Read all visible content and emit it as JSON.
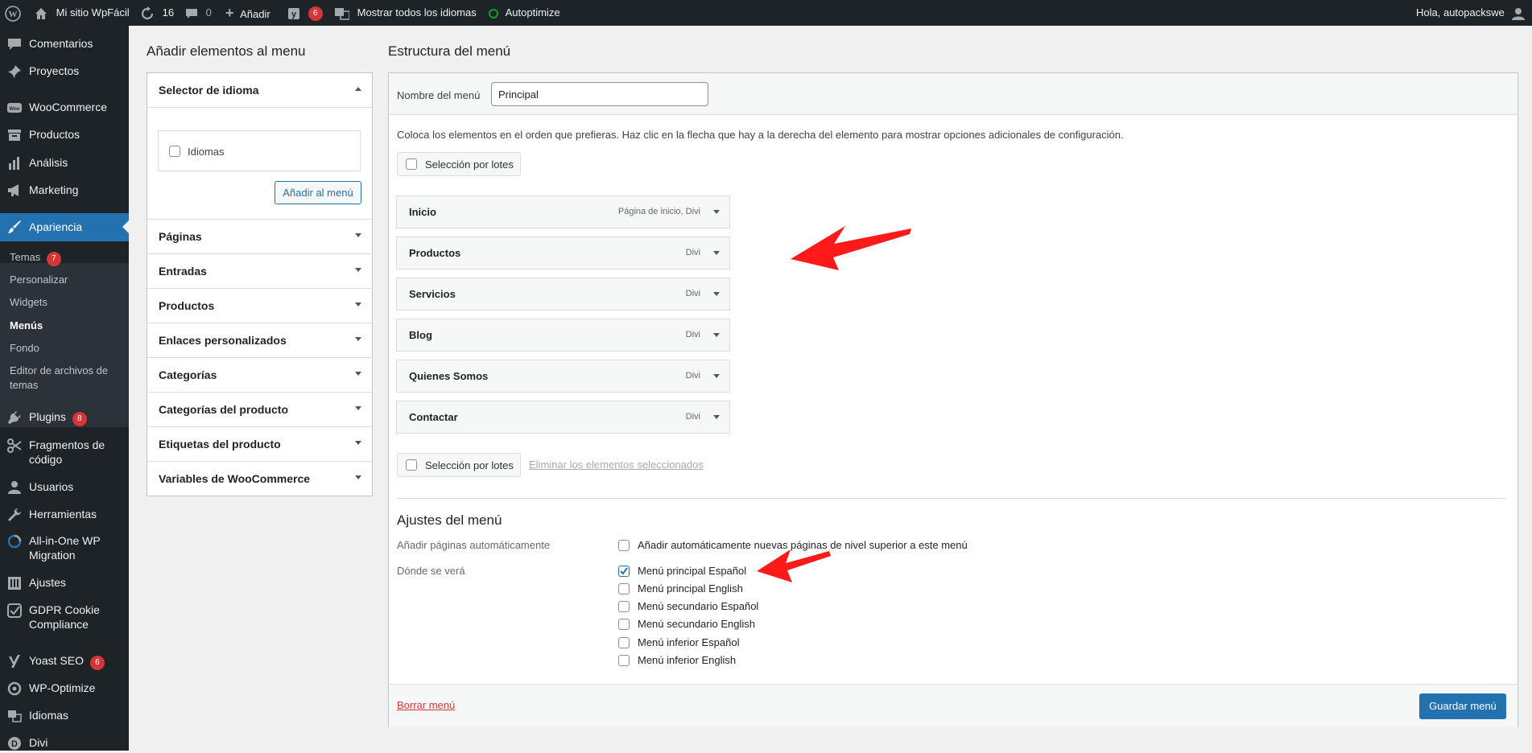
{
  "adminbar": {
    "site_name": "Mi sitio WpFácil",
    "updates_count": "16",
    "comments_count": "0",
    "add_new": "Añadir",
    "yoast_count": "6",
    "languages": "Mostrar todos los idiomas",
    "autoptimize": "Autoptimize",
    "greeting": "Hola, autopackswe"
  },
  "sidebar": {
    "items": [
      {
        "label": "Comentarios",
        "icon": "comments-icon"
      },
      {
        "label": "Proyectos",
        "icon": "pin-icon"
      },
      {
        "label": "WooCommerce",
        "icon": "woo-icon"
      },
      {
        "label": "Productos",
        "icon": "archive-icon"
      },
      {
        "label": "Análisis",
        "icon": "chart-icon"
      },
      {
        "label": "Marketing",
        "icon": "megaphone-icon"
      },
      {
        "label": "Apariencia",
        "icon": "brush-icon"
      },
      {
        "label": "Plugins",
        "icon": "plug-icon",
        "badge": "8"
      },
      {
        "label": "Fragmentos de código",
        "icon": "scissors-icon"
      },
      {
        "label": "Usuarios",
        "icon": "user-icon"
      },
      {
        "label": "Herramientas",
        "icon": "wrench-icon"
      },
      {
        "label": "All-in-One WP Migration",
        "icon": "migration-icon"
      },
      {
        "label": "Ajustes",
        "icon": "settings-icon"
      },
      {
        "label": "GDPR Cookie Compliance",
        "icon": "gdpr-icon"
      },
      {
        "label": "Yoast SEO",
        "icon": "yoast-icon",
        "badge": "6"
      },
      {
        "label": "WP-Optimize",
        "icon": "optimize-icon"
      },
      {
        "label": "Idiomas",
        "icon": "language-icon"
      },
      {
        "label": "Divi",
        "icon": "divi-icon"
      }
    ],
    "submenu": {
      "temas": "Temas",
      "temas_badge": "7",
      "personalizar": "Personalizar",
      "widgets": "Widgets",
      "menus": "Menús",
      "fondo": "Fondo",
      "editor": "Editor de archivos de temas"
    }
  },
  "left": {
    "title": "Añadir elementos al menu",
    "selector_title": "Selector de idioma",
    "idiomas_label": "Idiomas",
    "add_button": "Añadir al menú",
    "sections": [
      "Páginas",
      "Entradas",
      "Productos",
      "Enlaces personalizados",
      "Categorías",
      "Categorías del producto",
      "Etiquetas del producto",
      "Variables de WooCommerce"
    ]
  },
  "right": {
    "title": "Estructura del menú",
    "name_label": "Nombre del menú",
    "name_value": "Principal",
    "instructions": "Coloca los elementos en el orden que prefieras. Haz clic en la flecha que hay a la derecha del elemento para mostrar opciones adicionales de configuración.",
    "bulk_select": "Selección por lotes",
    "delete_selected": "Eliminar los elementos seleccionados",
    "items": [
      {
        "title": "Inicio",
        "type": "Página de inicio, Divi"
      },
      {
        "title": "Productos",
        "type": "Divi"
      },
      {
        "title": "Servicios",
        "type": "Divi"
      },
      {
        "title": "Blog",
        "type": "Divi"
      },
      {
        "title": "Quienes Somos",
        "type": "Divi"
      },
      {
        "title": "Contactar",
        "type": "Divi"
      }
    ],
    "settings_title": "Ajustes del menú",
    "auto_add_label": "Añadir páginas automáticamente",
    "auto_add_option": "Añadir automáticamente nuevas páginas de nivel superior a este menú",
    "location_label": "Dónde se verá",
    "locations": [
      {
        "label": "Menú principal Español",
        "checked": true
      },
      {
        "label": "Menú principal English",
        "checked": false
      },
      {
        "label": "Menú secundario Español",
        "checked": false
      },
      {
        "label": "Menú secundario English",
        "checked": false
      },
      {
        "label": "Menú inferior Español",
        "checked": false
      },
      {
        "label": "Menú inferior English",
        "checked": false
      }
    ],
    "delete_menu": "Borrar menú",
    "save_button": "Guardar menú"
  },
  "colors": {
    "accent": "#2271b1",
    "admin_bg": "#1d2327",
    "badge": "#d63638",
    "arrow_annotation": "#ff0000"
  }
}
